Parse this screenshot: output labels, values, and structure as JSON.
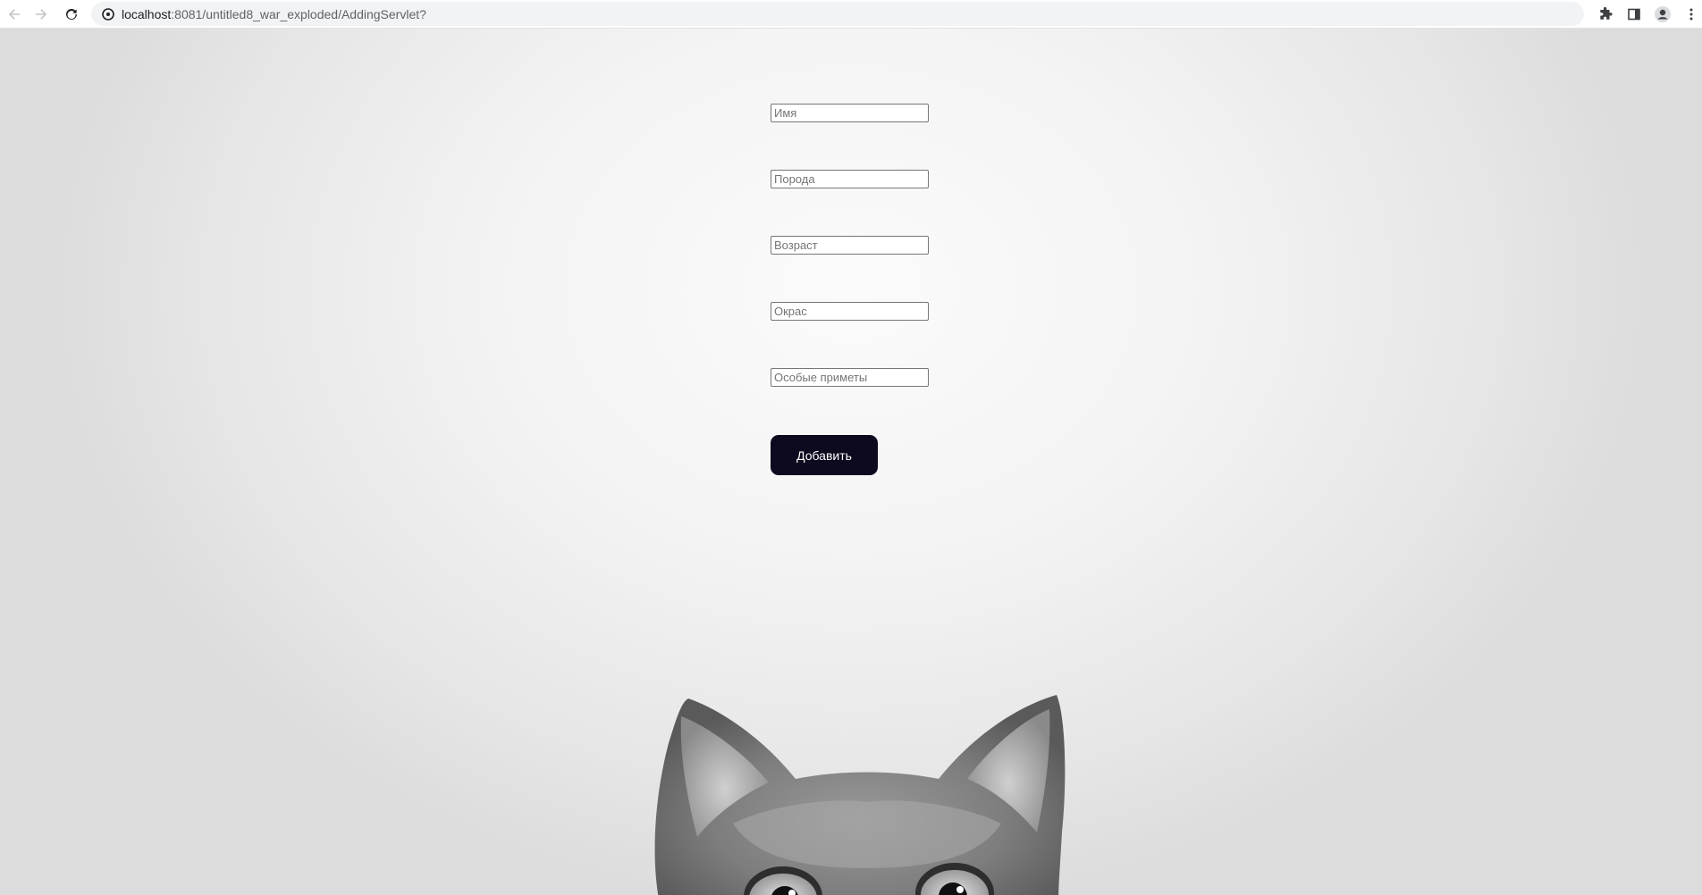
{
  "browser": {
    "url_host": "localhost",
    "url_path": ":8081/untitled8_war_exploded/AddingServlet?",
    "icons": [
      "back-arrow-icon",
      "forward-arrow-icon",
      "reload-icon",
      "site-info-icon",
      "extensions-icon",
      "side-panel-icon",
      "profile-icon",
      "more-menu-icon"
    ]
  },
  "form": {
    "name_placeholder": "Имя",
    "breed_placeholder": "Порода",
    "age_placeholder": "Возраст",
    "color_placeholder": "Окрас",
    "features_placeholder": "Особые приметы",
    "submit_label": "Добавить"
  },
  "colors": {
    "button_bg": "#0d0a1f",
    "button_text": "#ffffff",
    "page_bg": "#f3f3f3"
  }
}
